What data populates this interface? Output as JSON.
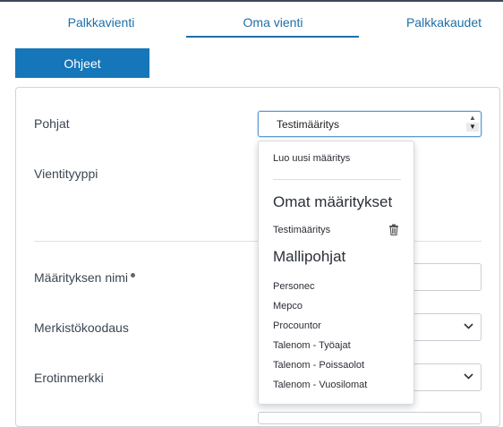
{
  "tabs": [
    "Palkkavienti",
    "Oma vienti",
    "Palkkakaudet"
  ],
  "help_button": "Ohjeet",
  "form": {
    "pohjat_label": "Pohjat",
    "pohjat_value": "Testimääritys",
    "vientityyppi_label": "Vientityyppi",
    "nimi_label": "Määrityksen nimi",
    "merkisto_label": "Merkistökoodaus",
    "erotin_label": "Erotinmerkki"
  },
  "dropdown": {
    "create_new": "Luo uusi määritys",
    "own_heading": "Omat määritykset",
    "own_items": [
      "Testimääritys"
    ],
    "templates_heading": "Mallipohjat",
    "templates": [
      "Personec",
      "Mepco",
      "Procountor",
      "Talenom - Työajat",
      "Talenom - Poissaolot",
      "Talenom - Vuosilomat"
    ]
  }
}
